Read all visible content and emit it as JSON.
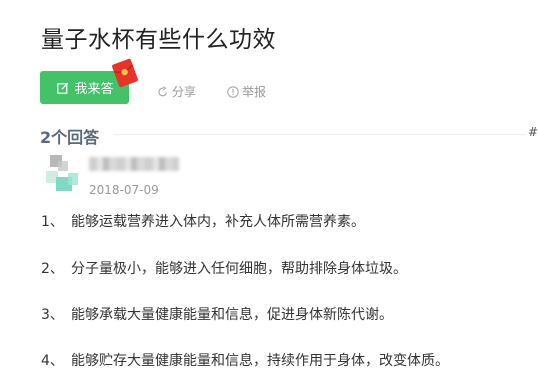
{
  "question": {
    "title": "量子水杯有些什么功效"
  },
  "actions": {
    "answer_label": "我来答",
    "share_label": "分享",
    "report_label": "举报"
  },
  "answers_header": {
    "count_label": "2个回答",
    "edge_text": "#"
  },
  "answer": {
    "date": "2018-07-09",
    "lines": [
      {
        "num": "1、",
        "text": "能够运载营养进入体内，补充人体所需营养素。"
      },
      {
        "num": "2、",
        "text": "分子量极小，能够进入任何细胞，帮助排除身体垃圾。"
      },
      {
        "num": "3、",
        "text": "能够承载大量健康能量和信息，促进身体新陈代谢。"
      },
      {
        "num": "4、",
        "text": "能够贮存大量健康能量和信息，持续作用于身体，改变体质。"
      }
    ]
  },
  "colors": {
    "accent_green": "#44c26a",
    "envelope_red": "#e8332b",
    "muted_text": "#999999",
    "count_text": "#5a6b77"
  },
  "icons": {
    "edit": "edit-icon",
    "red_envelope": "red-envelope-icon",
    "share": "share-icon",
    "report": "report-icon"
  }
}
